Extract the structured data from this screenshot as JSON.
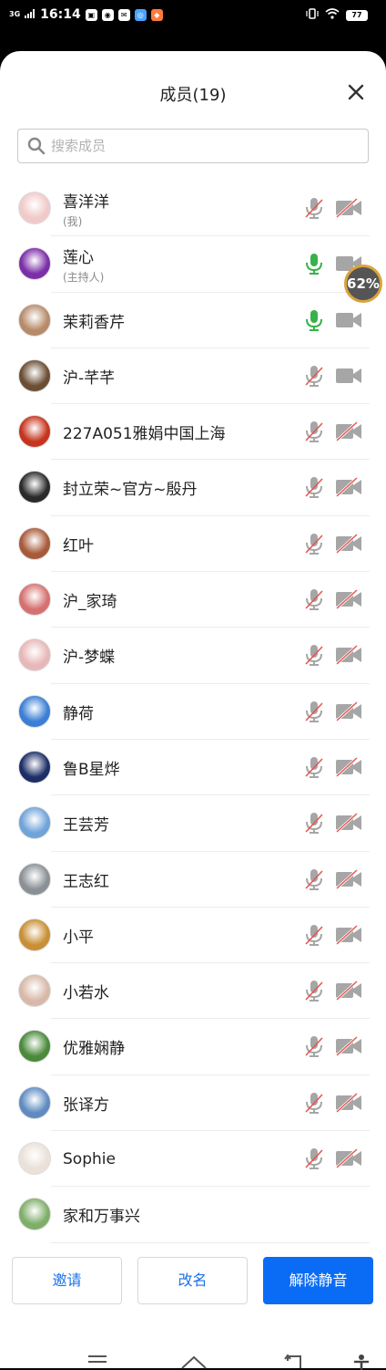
{
  "status": {
    "signal": "3G",
    "time": "16:14",
    "battery": "77"
  },
  "header": {
    "title": "成员(19)"
  },
  "search": {
    "placeholder": "搜索成员"
  },
  "float_badge": "62%",
  "members": [
    {
      "name": "喜洋洋",
      "role": "(我)",
      "mic": "off",
      "cam": "off",
      "avatar": "#f1c9c9"
    },
    {
      "name": "莲心",
      "role": "(主持人)",
      "mic": "on",
      "cam": "on",
      "avatar": "#7b2fa8"
    },
    {
      "name": "茉莉香芹",
      "role": "",
      "mic": "on",
      "cam": "on",
      "avatar": "#b78b6a"
    },
    {
      "name": "沪-芊芊",
      "role": "",
      "mic": "off",
      "cam": "on",
      "avatar": "#6b4e34"
    },
    {
      "name": "227A051雅娟中国上海",
      "role": "",
      "mic": "off",
      "cam": "off",
      "avatar": "#c6341d"
    },
    {
      "name": "封立荣~官方~殷丹",
      "role": "",
      "mic": "off",
      "cam": "off",
      "avatar": "#2a2a2a"
    },
    {
      "name": "红叶",
      "role": "",
      "mic": "off",
      "cam": "off",
      "avatar": "#a85a3a"
    },
    {
      "name": "沪_家琦",
      "role": "",
      "mic": "off",
      "cam": "off",
      "avatar": "#d67070"
    },
    {
      "name": "沪-梦蝶",
      "role": "",
      "mic": "off",
      "cam": "off",
      "avatar": "#e8b7b7"
    },
    {
      "name": "静荷",
      "role": "",
      "mic": "off",
      "cam": "off",
      "avatar": "#3a7ed6"
    },
    {
      "name": "鲁B星烨",
      "role": "",
      "mic": "off",
      "cam": "off",
      "avatar": "#1c2e66"
    },
    {
      "name": "王芸芳",
      "role": "",
      "mic": "off",
      "cam": "off",
      "avatar": "#6fa3d9"
    },
    {
      "name": "王志红",
      "role": "",
      "mic": "off",
      "cam": "off",
      "avatar": "#8a9096"
    },
    {
      "name": "小平",
      "role": "",
      "mic": "off",
      "cam": "off",
      "avatar": "#c98f34"
    },
    {
      "name": "小若水",
      "role": "",
      "mic": "off",
      "cam": "off",
      "avatar": "#d8b9a9"
    },
    {
      "name": "优雅娴静",
      "role": "",
      "mic": "off",
      "cam": "off",
      "avatar": "#4a8a3a"
    },
    {
      "name": "张译方",
      "role": "",
      "mic": "off",
      "cam": "off",
      "avatar": "#5f8bc2"
    },
    {
      "name": "Sophie",
      "role": "",
      "mic": "off",
      "cam": "off",
      "avatar": "#eae1d8"
    },
    {
      "name": "家和万事兴",
      "role": "",
      "mic": "none",
      "cam": "none",
      "avatar": "#7fae6a"
    }
  ],
  "actions": {
    "invite": "邀请",
    "rename": "改名",
    "unmute": "解除静音"
  },
  "colors": {
    "accent": "#0a6cf5",
    "mic_on": "#36b24a",
    "icon_gray": "#a6a6a6",
    "muted_slash": "#e6564e"
  }
}
